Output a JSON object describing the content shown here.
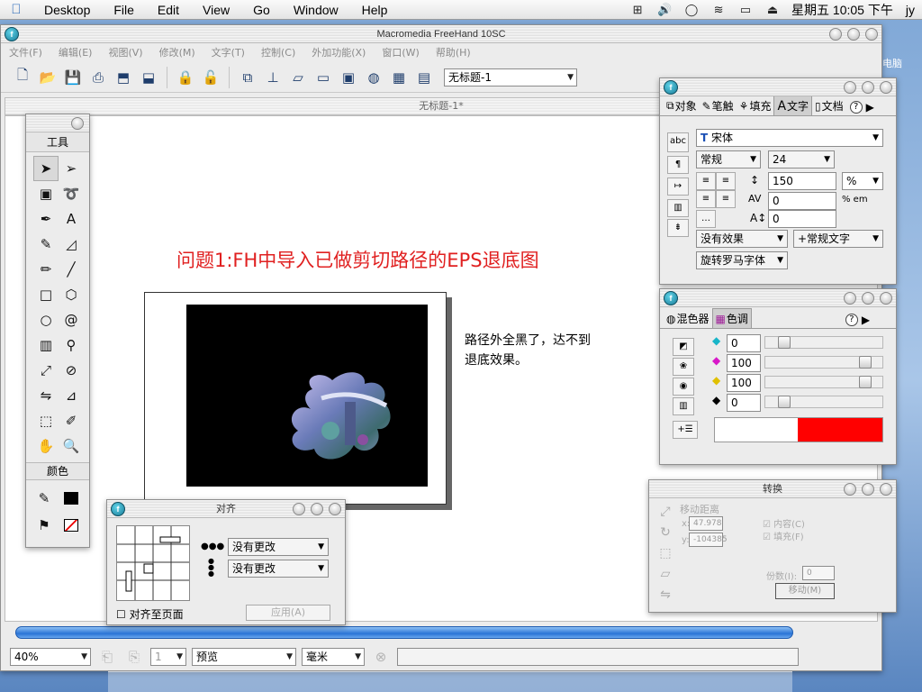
{
  "menubar": {
    "items": [
      "Desktop",
      "File",
      "Edit",
      "View",
      "Go",
      "Window",
      "Help"
    ],
    "clock": "星期五 10:05 下午",
    "user": "jy"
  },
  "app": {
    "title": "Macromedia FreeHand 10SC",
    "menu": [
      "文件(F)",
      "编辑(E)",
      "视图(V)",
      "修改(M)",
      "文字(T)",
      "控制(C)",
      "外加功能(X)",
      "窗口(W)",
      "帮助(H)"
    ],
    "doc_select": "无标题-1",
    "doc_title": "无标题-1*"
  },
  "document": {
    "heading": "问题1:FH中导入已做剪切路径的EPS退底图",
    "note": "路径外全黑了，达不到\n退底效果。"
  },
  "tools": {
    "header": "工具",
    "colors_header": "颜色"
  },
  "text_panel": {
    "tabs": [
      "对象",
      "笔触",
      "填充",
      "文字",
      "文档"
    ],
    "font": "宋体",
    "style": "常规",
    "size": "24",
    "leading": "150",
    "leading_unit": "%",
    "tracking": "0",
    "tracking_unit": "% em",
    "baseline": "0",
    "effect": "没有效果",
    "text_style": "+常规文字",
    "rotation": "旋转罗马字体",
    "abc_label": "abc"
  },
  "mixer_panel": {
    "tabs": [
      "混色器",
      "色调"
    ],
    "values": [
      "0",
      "100",
      "100",
      "0"
    ],
    "swatch_color": "#ff0000"
  },
  "xform_panel": {
    "title": "转换",
    "move_distance": "移动距离",
    "x_value": "47.978",
    "y_value": "-104385",
    "contents_label": "内容(C)",
    "fill_label": "填充(F)",
    "copies_label": "份数(I):",
    "copies_value": "0",
    "move_button": "移动(M)"
  },
  "align_panel": {
    "title": "对齐",
    "horizontal": "没有更改",
    "vertical": "没有更改",
    "to_page": "对齐至页面",
    "apply": "应用(A)"
  },
  "statusbar": {
    "zoom": "40%",
    "page": "1",
    "mode": "预览",
    "unit": "毫米"
  },
  "desktop": {
    "computer_label": "电脑"
  }
}
